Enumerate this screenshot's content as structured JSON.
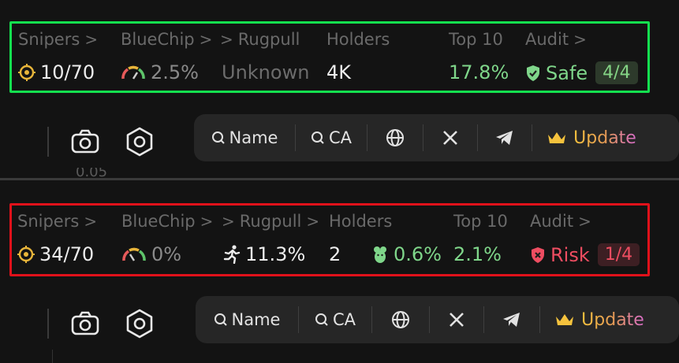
{
  "panels": [
    {
      "id": "top",
      "status": "safe",
      "headers": {
        "snipers": "Snipers",
        "bluechip": "BlueChip",
        "rugpull": "Rugpull",
        "holders": "Holders",
        "top10": "Top 10",
        "audit": "Audit"
      },
      "values": {
        "snipers": "10/70",
        "bluechip": "2.5%",
        "rugpull": "Unknown",
        "holders": "4K",
        "insiders": "",
        "top10": "17.8%",
        "audit_label": "Safe",
        "audit_score": "4/4"
      },
      "toolbar": {
        "search_name": "Name",
        "search_ca": "CA",
        "update": "Update"
      },
      "below_text": "0.05"
    },
    {
      "id": "bottom",
      "status": "risk",
      "headers": {
        "snipers": "Snipers",
        "bluechip": "BlueChip",
        "rugpull": "Rugpull",
        "holders": "Holders",
        "top10": "Top 10",
        "audit": "Audit"
      },
      "values": {
        "snipers": "34/70",
        "bluechip": "0%",
        "rugpull": "11.3%",
        "holders": "2",
        "insiders": "0.6%",
        "top10": "2.1%",
        "audit_label": "Risk",
        "audit_score": "1/4"
      },
      "toolbar": {
        "search_name": "Name",
        "search_ca": "CA",
        "update": "Update"
      }
    }
  ],
  "chevron": ">",
  "colors": {
    "safe_border": "#14e04f",
    "risk_border": "#e0111a",
    "safe_text": "#7fd68a",
    "risk_text": "#ee4d61",
    "accent_yellow": "#f5c23d"
  },
  "icons": [
    "target-icon",
    "gauge-icon",
    "runner-icon",
    "rat-icon",
    "shield-check-icon",
    "shield-x-icon",
    "camera-icon",
    "hexagon-settings-icon",
    "search-icon",
    "globe-icon",
    "x-logo-icon",
    "telegram-icon",
    "crown-icon"
  ]
}
